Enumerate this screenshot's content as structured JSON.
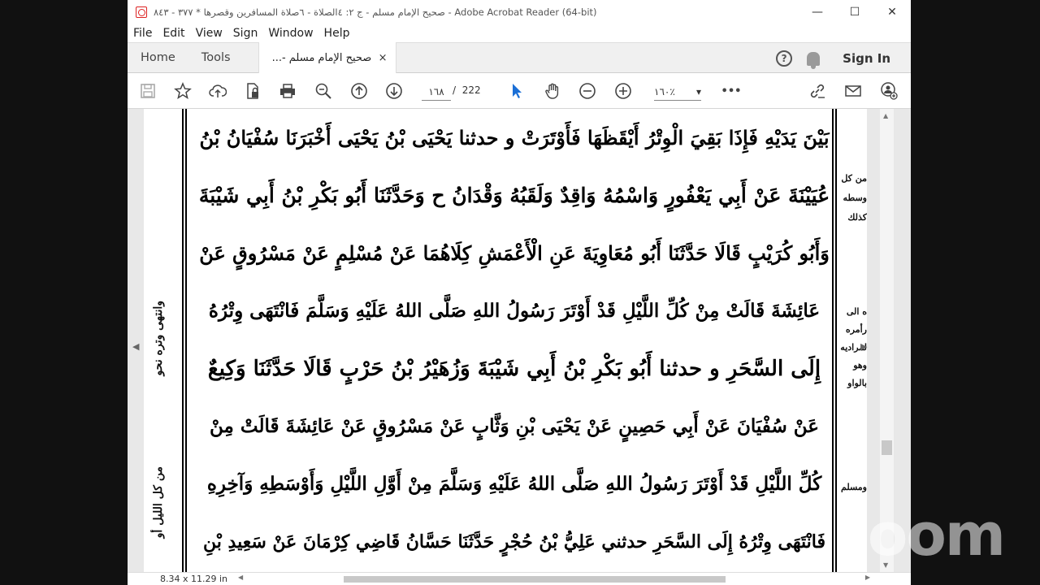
{
  "window": {
    "title": "صحيح الإمام مسلم - ج ٢: ٤الصلاة - ٦صلاة المسافرين وقصرها * ٣٧٧ - ٨٤٣ - Adobe Acrobat Reader (64-bit)",
    "minimize": "—",
    "maximize": "☐",
    "close": "✕"
  },
  "menu": [
    "File",
    "Edit",
    "View",
    "Sign",
    "Window",
    "Help"
  ],
  "tabs": {
    "home": "Home",
    "tools": "Tools",
    "document": "صحيح الإمام مسلم -...",
    "close": "×",
    "sign_in": "Sign In",
    "help": "?"
  },
  "toolbar": {
    "page_current": "١٦٨",
    "page_separator": "/",
    "page_total": "222",
    "zoom": "١٦٠٪",
    "zoom_caret": "▾",
    "more": "•••"
  },
  "document": {
    "lines": [
      "بَيْنَ يَدَيْهِ فَإِذَا بَقِيَ الْوِتْرُ أَيْقَظَهَا فَأَوْتَرَتْ و حدثنا يَحْيَى بْنُ يَحْيَى أَخْبَرَنَا سُفْيَانُ بْنُ",
      "عُيَيْنَةَ عَنْ أَبِي يَعْفُورٍ وَاسْمُهُ وَاقِدٌ وَلَقَبُهُ وَقْدَانُ ح وَحَدَّثَنَا أَبُو بَكْرِ بْنُ أَبِي شَيْبَةَ",
      "وَأَبُو كُرَيْبٍ قَالَا حَدَّثَنَا أَبُو مُعَاوِيَةَ عَنِ الْأَعْمَشِ كِلَاهُمَا عَنْ مُسْلِمٍ عَنْ مَسْرُوقٍ عَنْ",
      "عَائِشَةَ قَالَتْ مِنْ كُلِّ اللَّيْلِ قَدْ أَوْتَرَ رَسُولُ اللهِ صَلَّى اللهُ عَلَيْهِ وَسَلَّمَ فَانْتَهَى وِتْرُهُ",
      "إِلَى السَّحَرِ و حدثنا أَبُو بَكْرِ بْنُ أَبِي شَيْبَةَ وَزُهَيْرُ بْنُ حَرْبٍ قَالَا حَدَّثَنَا وَكِيعٌ",
      "عَنْ سُفْيَانَ عَنْ أَبِي حَصِينٍ عَنْ يَحْيَى بْنِ وَثَّابٍ عَنْ مَسْرُوقٍ عَنْ عَائِشَةَ قَالَتْ مِنْ",
      "كُلِّ اللَّيْلِ قَدْ أَوْتَرَ رَسُولُ اللهِ صَلَّى اللهُ عَلَيْهِ وَسَلَّمَ مِنْ أَوَّلِ اللَّيْلِ وَأَوْسَطِهِ وَآخِرِهِ",
      "فَانْتَهَى وِتْرُهُ إِلَى السَّحَرِ حدثني عَلِيُّ بْنُ حُجْرٍ حَدَّثَنَا حَسَّانُ قَاضِي كِرْمَانَ عَنْ سَعِيدِ بْنِ"
    ],
    "right_margin": [
      "من كل",
      "وسطه",
      "كذلك",
      "ه الى",
      "رأمره",
      "لمراديه",
      "وهو",
      "بالواو",
      "ومسلم"
    ],
    "left_margin": [
      "وانتهى وتره نحو",
      "من كل الليل أو"
    ]
  },
  "status": {
    "page_size": "8.34 x 11.29 in"
  },
  "overlay": {
    "logo": "zoom"
  }
}
